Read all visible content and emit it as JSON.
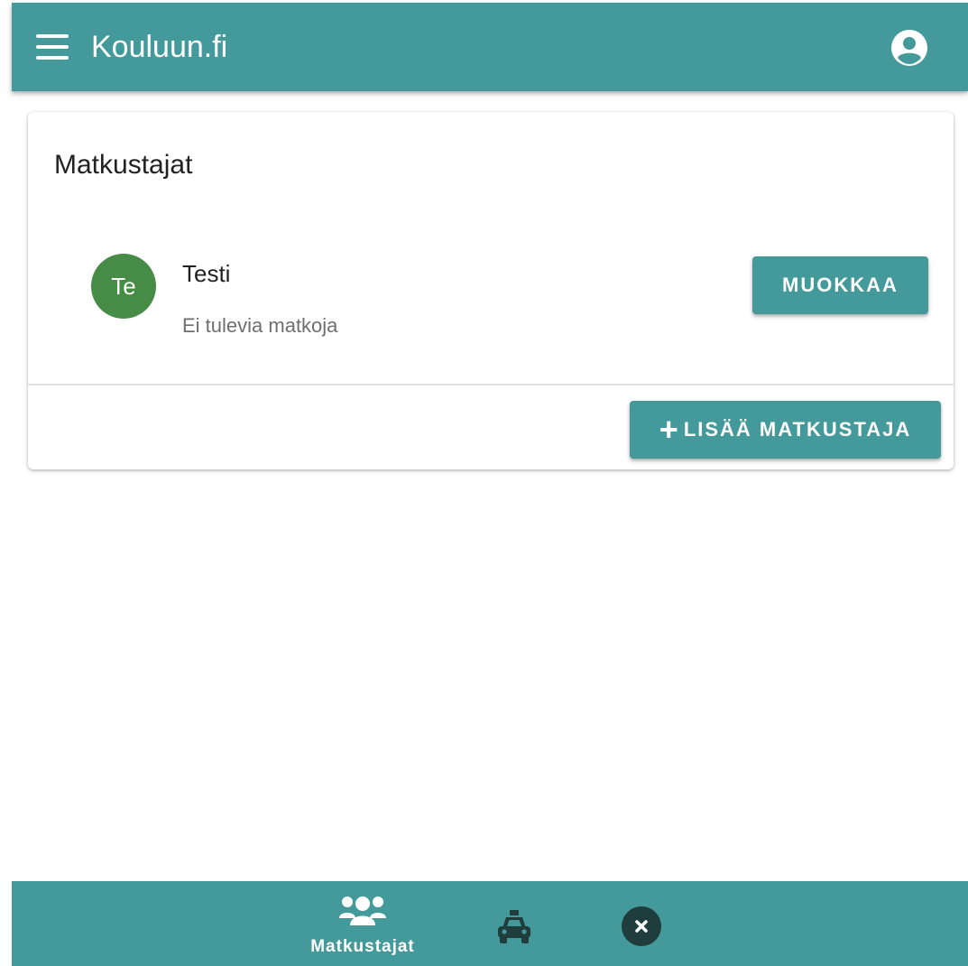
{
  "header": {
    "title": "Kouluun.fi",
    "menu_icon": "menu-icon",
    "account_icon": "account-circle-icon"
  },
  "card": {
    "title": "Matkustajat",
    "passengers": [
      {
        "initials": "Te",
        "name": "Testi",
        "subtitle": "Ei tulevia matkoja",
        "avatar_color": "#468b46",
        "edit_label": "MUOKKAA"
      }
    ],
    "add_label": "LISÄÄ MATKUSTAJA",
    "add_icon": "plus-icon"
  },
  "bottom_nav": {
    "items": [
      {
        "label": "Matkustajat",
        "icon": "users-icon",
        "active": true
      },
      {
        "icon": "taxi-icon",
        "active": false
      },
      {
        "icon": "close-circle-icon",
        "active": false
      }
    ]
  },
  "colors": {
    "primary": "#449a9a",
    "nav_inactive_icon": "#1f3d3d",
    "card_background": "#ffffff"
  }
}
